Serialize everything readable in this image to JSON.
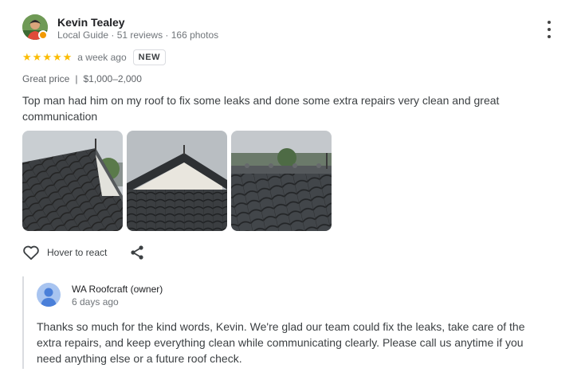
{
  "review": {
    "reviewer_name": "Kevin Tealey",
    "reviewer_meta": "Local Guide · 51 reviews · 166 photos",
    "rating": 5,
    "stars": [
      "★",
      "★",
      "★",
      "★",
      "★"
    ],
    "date": "a week ago",
    "badge": "NEW",
    "price_label": "Great price",
    "price_separator": "|",
    "price_range": "$1,000–2,000",
    "text": "Top man had him on my roof to fix some leaks and done some extra repairs very clean and great communication",
    "photos": [
      {
        "icon": "roof-photo-1"
      },
      {
        "icon": "roof-photo-2"
      },
      {
        "icon": "roof-photo-3"
      }
    ],
    "react_label": "Hover to react",
    "colors": {
      "star": "#fbbc04",
      "meta_text": "#70757a",
      "body_text": "#3c4043"
    }
  },
  "owner_reply": {
    "name": "WA Roofcraft (owner)",
    "date": "6 days ago",
    "text": "Thanks so much for the kind words, Kevin. We're glad our team could fix the leaks, take care of the extra repairs, and keep everything clean while communicating clearly. Please call us anytime if you need anything else or a future roof check.",
    "avatar_color": "#4a7fd9"
  }
}
